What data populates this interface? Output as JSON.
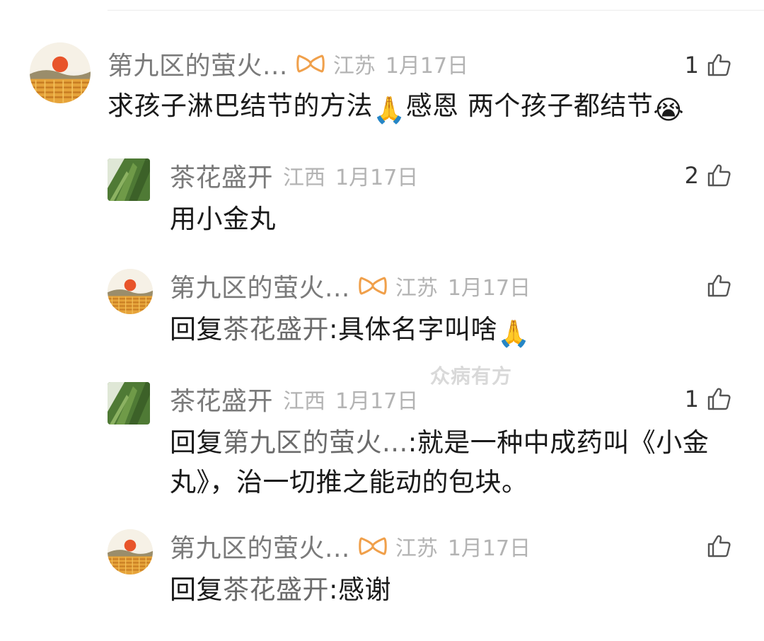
{
  "colors": {
    "username": "#7a7a7a",
    "meta": "#b3b3b3",
    "text": "#1a1a1a",
    "badge": "#f0a04b",
    "like_icon": "#555555",
    "watermark": "#d9d9d9"
  },
  "watermark": "众病有方",
  "comments": [
    {
      "username": "第九区的萤火...",
      "badge_icon": "badge-icon",
      "location": "江苏",
      "date": "1月17日",
      "like_count": "1",
      "text_before": "求孩子淋巴结节的方法",
      "text_emoji1": "🙏",
      "text_middle": "感恩 两个孩子都结节",
      "text_emoji2": "😭"
    },
    {
      "username": "茶花盛开",
      "location": "江西",
      "date": "1月17日",
      "like_count": "2",
      "text": "用小金丸"
    },
    {
      "username": "第九区的萤火...",
      "badge_icon": "badge-icon",
      "location": "江苏",
      "date": "1月17日",
      "like_count": "",
      "reply_prefix": "回复",
      "reply_target": "茶花盛开",
      "text": ":具体名字叫啥",
      "text_emoji": "🙏"
    },
    {
      "username": "茶花盛开",
      "location": "江西",
      "date": "1月17日",
      "like_count": "1",
      "reply_prefix": "回复",
      "reply_target": "第九区的萤火...",
      "text_line1": ":就是一种中成药叫《小金",
      "text_line2": "丸》，治一切推之能动的包块。"
    },
    {
      "username": "第九区的萤火...",
      "badge_icon": "badge-icon",
      "location": "江苏",
      "date": "1月17日",
      "like_count": "",
      "reply_prefix": "回复",
      "reply_target": "茶花盛开",
      "text": ":感谢"
    }
  ]
}
